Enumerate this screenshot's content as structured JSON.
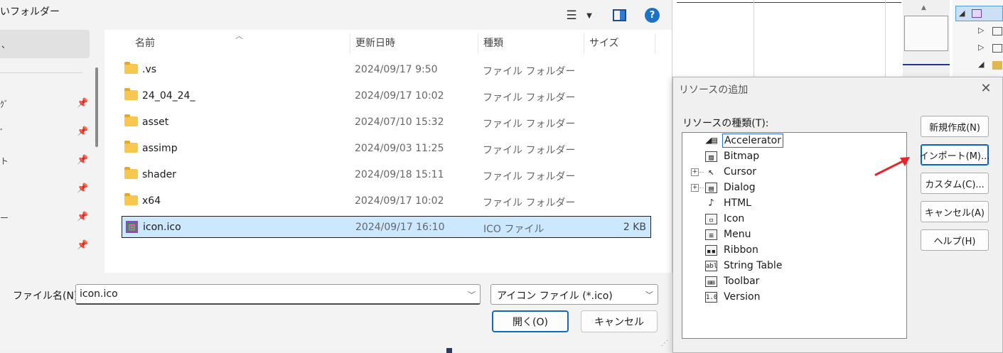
{
  "file_dialog": {
    "title": "いフォルダー",
    "nav": {
      "selected_label": "、",
      "items": [
        {
          "label": "ｸﾞ"
        },
        {
          "label": "ﾞ"
        },
        {
          "label": "ト"
        },
        {
          "label": ""
        },
        {
          "label": "ー"
        },
        {
          "label": ""
        }
      ]
    },
    "columns": {
      "name": "名前",
      "date": "更新日時",
      "type": "種類",
      "size": "サイズ"
    },
    "files": [
      {
        "name": ".vs",
        "date": "2024/09/17 9:50",
        "type": "ファイル フォルダー",
        "size": "",
        "icon": "folder-icon"
      },
      {
        "name": "24_04_24_",
        "date": "2024/09/17 10:02",
        "type": "ファイル フォルダー",
        "size": "",
        "icon": "folder-icon"
      },
      {
        "name": "asset",
        "date": "2024/07/10 15:32",
        "type": "ファイル フォルダー",
        "size": "",
        "icon": "folder-icon"
      },
      {
        "name": "assimp",
        "date": "2024/09/03 11:25",
        "type": "ファイル フォルダー",
        "size": "",
        "icon": "folder-icon"
      },
      {
        "name": "shader",
        "date": "2024/09/18 15:11",
        "type": "ファイル フォルダー",
        "size": "",
        "icon": "folder-icon"
      },
      {
        "name": "x64",
        "date": "2024/09/17 10:02",
        "type": "ファイル フォルダー",
        "size": "",
        "icon": "folder-icon"
      },
      {
        "name": "icon.ico",
        "date": "2024/09/17 16:10",
        "type": "ICO ファイル",
        "size": "2 KB",
        "icon": "ico-file-icon",
        "selected": true
      }
    ],
    "filename_label": "ファイル名(N):",
    "filename_value": "icon.ico",
    "filetype_value": "アイコン ファイル (*.ico)",
    "open_label": "開く(O)",
    "cancel_label": "キャンセル",
    "help_glyph": "?"
  },
  "add_resource": {
    "title": "リソースの追加",
    "list_label": "リソースの種類(T):",
    "items": [
      {
        "label": "Accelerator",
        "icon": "accelerator-icon",
        "glyph": "◢▤",
        "expandable": false,
        "focused": true
      },
      {
        "label": "Bitmap",
        "icon": "bitmap-icon",
        "glyph": "▨",
        "expandable": false
      },
      {
        "label": "Cursor",
        "icon": "cursor-icon",
        "glyph": "↖",
        "expandable": true
      },
      {
        "label": "Dialog",
        "icon": "dialog-icon",
        "glyph": "▤",
        "expandable": true
      },
      {
        "label": "HTML",
        "icon": "html-icon",
        "glyph": "♪",
        "expandable": false
      },
      {
        "label": "Icon",
        "icon": "icon-resource-icon",
        "glyph": "▫",
        "expandable": false
      },
      {
        "label": "Menu",
        "icon": "menu-icon",
        "glyph": "≡",
        "expandable": false
      },
      {
        "label": "Ribbon",
        "icon": "ribbon-icon",
        "glyph": "▪▪",
        "expandable": false
      },
      {
        "label": "String Table",
        "icon": "string-table-icon",
        "glyph": "abl",
        "expandable": false
      },
      {
        "label": "Toolbar",
        "icon": "toolbar-icon",
        "glyph": "▤▤",
        "expandable": false
      },
      {
        "label": "Version",
        "icon": "version-icon",
        "glyph": "1.0",
        "expandable": false
      }
    ],
    "buttons": {
      "new": "新規作成(N)",
      "import": "インポート(M)...",
      "custom": "カスタム(C)...",
      "cancel": "キャンセル(A)",
      "help": "ヘルプ(H)"
    },
    "expander_glyph": "+"
  },
  "colors": {
    "annotation_arrow": "#e8232a",
    "selection": "#cce8ff",
    "accent": "#0f6cbd"
  }
}
